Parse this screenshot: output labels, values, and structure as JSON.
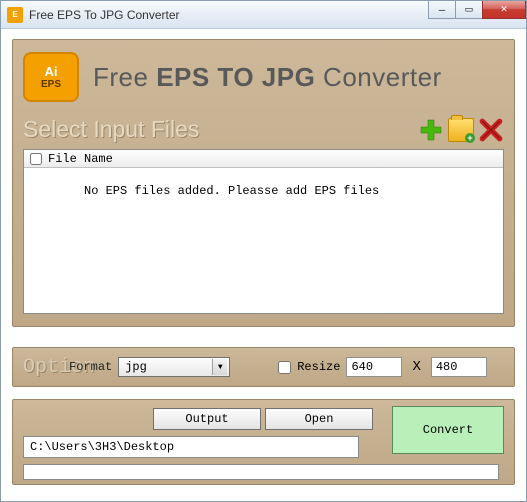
{
  "titlebar": {
    "title": "Free EPS To JPG Converter"
  },
  "header": {
    "logo_top": "Ai",
    "logo_bottom": "EPS",
    "title_light": "Free ",
    "title_bold": "EPS TO JPG",
    "title_light2": " Converter"
  },
  "section": {
    "label": "Select Input Files"
  },
  "filelist": {
    "column": "File Name",
    "empty_msg": "No EPS files added. Pleasse add EPS files"
  },
  "options": {
    "label": "Option",
    "format_label": "Format",
    "format_value": "jpg",
    "resize_label": "Resize",
    "width": "640",
    "x": "X",
    "height": "480"
  },
  "bottom": {
    "output_btn": "Output",
    "open_btn": "Open",
    "convert_btn": "Convert",
    "path": "C:\\Users\\3H3\\Desktop"
  }
}
